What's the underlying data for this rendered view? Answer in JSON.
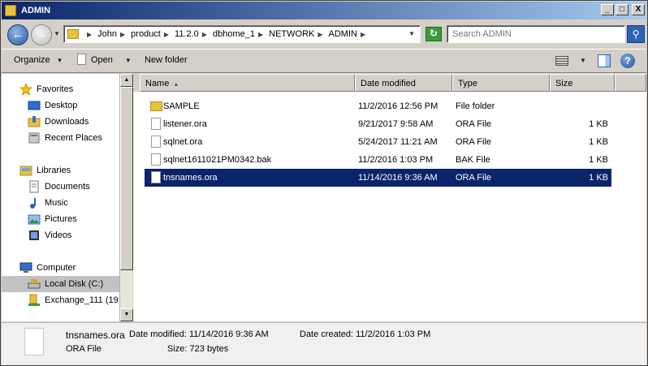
{
  "window": {
    "title": "ADMIN",
    "buttons": {
      "minimize": "_",
      "maximize": "□",
      "close": "X"
    }
  },
  "address": {
    "breadcrumbs": [
      "John",
      "product",
      "11.2.0",
      "dbhome_1",
      "NETWORK",
      "ADMIN"
    ],
    "search_placeholder": "Search ADMIN"
  },
  "toolbar": {
    "organize_label": "Organize",
    "open_label": "Open",
    "new_folder_label": "New folder"
  },
  "nav": {
    "favorites_label": "Favorites",
    "favorites": [
      "Desktop",
      "Downloads",
      "Recent Places"
    ],
    "libraries_label": "Libraries",
    "libraries": [
      "Documents",
      "Music",
      "Pictures",
      "Videos"
    ],
    "computer_label": "Computer",
    "computer": [
      "Local Disk (C:)",
      "Exchange_111 (19"
    ],
    "selected": "Local Disk (C:)"
  },
  "columns": [
    "Name",
    "Date modified",
    "Type",
    "Size"
  ],
  "files": [
    {
      "name": "SAMPLE",
      "date": "11/2/2016 12:56 PM",
      "type": "File folder",
      "size": "",
      "icon": "folder-icon"
    },
    {
      "name": "listener.ora",
      "date": "9/21/2017 9:58 AM",
      "type": "ORA File",
      "size": "1 KB",
      "icon": "file-icon"
    },
    {
      "name": "sqlnet.ora",
      "date": "5/24/2017 11:21 AM",
      "type": "ORA File",
      "size": "1 KB",
      "icon": "file-icon"
    },
    {
      "name": "sqlnet1611021PM0342.bak",
      "date": "11/2/2016 1:03 PM",
      "type": "BAK File",
      "size": "1 KB",
      "icon": "file-icon"
    },
    {
      "name": "tnsnames.ora",
      "date": "11/14/2016 9:36 AM",
      "type": "ORA File",
      "size": "1 KB",
      "icon": "file-icon",
      "selected": true
    }
  ],
  "details": {
    "filename": "tnsnames.ora",
    "filetype": "ORA File",
    "date_modified_label": "Date modified:",
    "date_modified": "11/14/2016 9:36 AM",
    "date_created_label": "Date created:",
    "date_created": "11/2/2016 1:03 PM",
    "size_label": "Size:",
    "size": "723 bytes"
  },
  "colors": {
    "selection": "#0a246a",
    "titlebar_start": "#0a246a",
    "titlebar_end": "#a6caf0"
  }
}
